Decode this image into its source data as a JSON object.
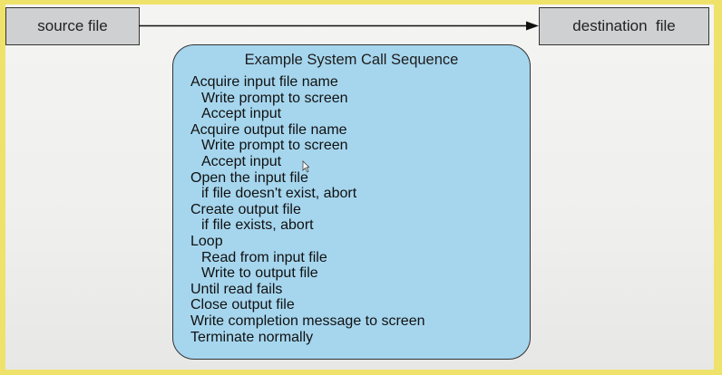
{
  "diagram": {
    "source_label": "source file",
    "destination_label": "destination  file",
    "sequence_title": "Example System Call Sequence",
    "steps": [
      {
        "text": "Acquire input file name",
        "indent": false
      },
      {
        "text": "Write prompt to screen",
        "indent": true
      },
      {
        "text": "Accept input",
        "indent": true
      },
      {
        "text": "Acquire output file name",
        "indent": false
      },
      {
        "text": "Write prompt to screen",
        "indent": true
      },
      {
        "text": "Accept input",
        "indent": true
      },
      {
        "text": "Open the input file",
        "indent": false
      },
      {
        "text": "if file doesn't exist, abort",
        "indent": true
      },
      {
        "text": "Create output file",
        "indent": false
      },
      {
        "text": "if file exists, abort",
        "indent": true
      },
      {
        "text": "Loop",
        "indent": false
      },
      {
        "text": "Read from input file",
        "indent": true
      },
      {
        "text": "Write to output file",
        "indent": true
      },
      {
        "text": "Until read fails",
        "indent": false
      },
      {
        "text": "Close output file",
        "indent": false
      },
      {
        "text": "Write completion message to screen",
        "indent": false
      },
      {
        "text": "Terminate normally",
        "indent": false
      }
    ]
  },
  "colors": {
    "panel_fill": "#a6d6ee",
    "file_box_fill": "#cfd0d2",
    "frame": "#efe26a"
  }
}
